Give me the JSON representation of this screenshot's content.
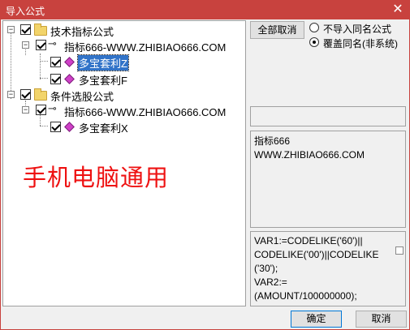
{
  "window": {
    "title": "导入公式",
    "close_glyph": "✕"
  },
  "tree": {
    "expand_glyph": "−",
    "groups": [
      {
        "label": "技术指标公式",
        "source": "指标666-WWW.ZHIBIAO666.COM",
        "items": [
          "多宝套利Z",
          "多宝套利F"
        ]
      },
      {
        "label": "条件选股公式",
        "source": "指标666-WWW.ZHIBIAO666.COM",
        "items": [
          "多宝套利X"
        ]
      }
    ],
    "selected_item": "多宝套利Z"
  },
  "watermark": "手机电脑通用",
  "options": {
    "deselect_all_label": "全部取消",
    "radio_skip_label": "不导入同名公式",
    "radio_overwrite_label": "覆盖同名(非系统)",
    "selected": "overwrite"
  },
  "info_panel": {
    "text": "指标666\nWWW.ZHIBIAO666.COM"
  },
  "code_panel": {
    "text": "VAR1:=CODELIKE('60')||\nCODELIKE('00')||CODELIKE\n('30');\nVAR2:=\n(AMOUNT/100000000);"
  },
  "footer": {
    "ok_label": "确定",
    "cancel_label": "取消"
  }
}
